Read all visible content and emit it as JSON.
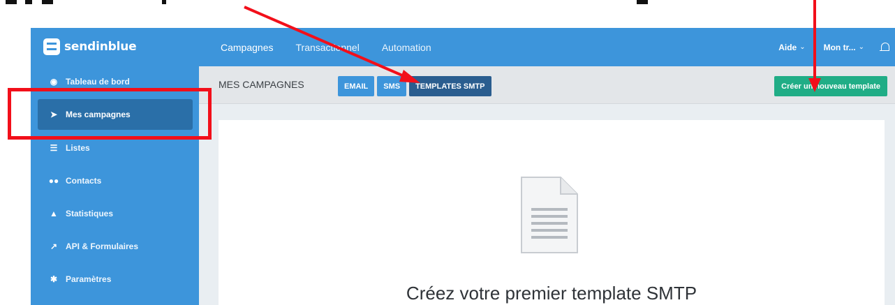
{
  "app": {
    "logo_text": "sendinblue"
  },
  "topnav": {
    "items": [
      {
        "label": "Campagnes",
        "active": true
      },
      {
        "label": "Transactionnel",
        "active": false
      },
      {
        "label": "Automation",
        "active": false
      }
    ],
    "right": {
      "help": "Aide",
      "account": "Mon tr..."
    }
  },
  "sidebar": {
    "items": [
      {
        "label": "Tableau de bord",
        "icon": "dashboard-icon"
      },
      {
        "label": "Mes campagnes",
        "icon": "paper-plane-icon",
        "active": true
      },
      {
        "label": "Listes",
        "icon": "list-icon"
      },
      {
        "label": "Contacts",
        "icon": "users-icon"
      },
      {
        "label": "Statistiques",
        "icon": "area-chart-icon"
      },
      {
        "label": "API & Formulaires",
        "icon": "wrench-icon"
      },
      {
        "label": "Paramètres",
        "icon": "gear-icon"
      }
    ]
  },
  "subheader": {
    "title": "MES CAMPAGNES",
    "tabs": [
      {
        "label": "EMAIL"
      },
      {
        "label": "SMS"
      },
      {
        "label": "TEMPLATES SMTP",
        "active": true
      }
    ],
    "create_button": "Créer un nouveau template"
  },
  "main": {
    "empty_title": "Créez votre premier template SMTP"
  },
  "colors": {
    "brand_blue": "#3d95db",
    "active_blue": "#2a6fa8",
    "active_tab": "#2a5d8f",
    "create_green": "#20ad86",
    "annotation_red": "#f20f1a"
  }
}
